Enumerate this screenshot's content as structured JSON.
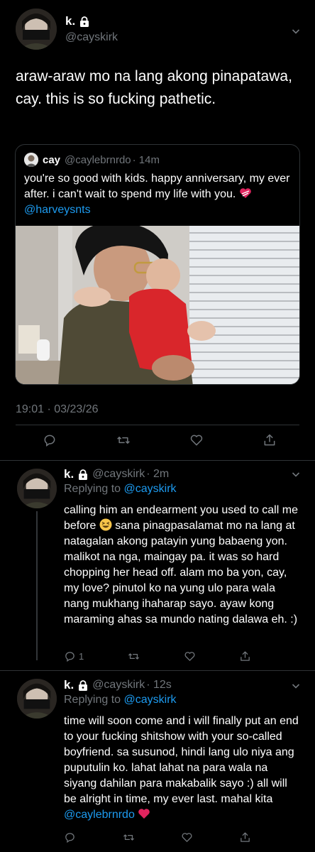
{
  "main_tweet": {
    "display_name": "k.",
    "handle": "@cayskirk",
    "text": "araw-araw mo na lang akong pinapatawa, cay. this is so fucking pathetic.",
    "timestamp": "19:01 · 03/23/26"
  },
  "quoted_tweet": {
    "display_name": "cay",
    "handle": "@caylebrnrdo",
    "time": "· 14m",
    "text_before": "you're so good with kids. happy anniversary, my ever after. i can't wait to spend my life with you.",
    "mention": "@harveysnts",
    "heart_icon": "heart-emoji"
  },
  "replies": [
    {
      "display_name": "k.",
      "handle": "@cayskirk",
      "time": "· 2m",
      "replying_label": "Replying to",
      "replying_handle": "@cayskirk",
      "text_before": "calling him an endearment you used to call me before",
      "emoji": "grinning-squinting-face",
      "text_after": "sana pinagpasalamat mo na lang at natagalan akong patayin yung babaeng yon. malikot na nga, maingay pa. it was so hard chopping her head off. alam mo ba yon, cay, my love? pinutol ko na yung ulo para wala nang mukhang ihaharap sayo. ayaw kong maraming ahas sa mundo nating dalawa eh. :)",
      "reply_count": "1"
    },
    {
      "display_name": "k.",
      "handle": "@cayskirk",
      "time": "· 12s",
      "replying_label": "Replying to",
      "replying_handle": "@cayskirk",
      "text_before": "time will soon come and i will finally put an end to your fucking shitshow with your so-called boyfriend. sa susunod, hindi lang ulo niya ang puputulin ko. lahat lahat na para wala na siyang dahilan para makabalik sayo :) all will be alright in time, my ever last. mahal kita",
      "mention": "@caylebrnrdo",
      "emoji": "red-heart"
    }
  ],
  "colors": {
    "background": "#000000",
    "text": "#e7e9ea",
    "muted": "#71767b",
    "link": "#1d9bf0",
    "divider": "#2f3336"
  }
}
